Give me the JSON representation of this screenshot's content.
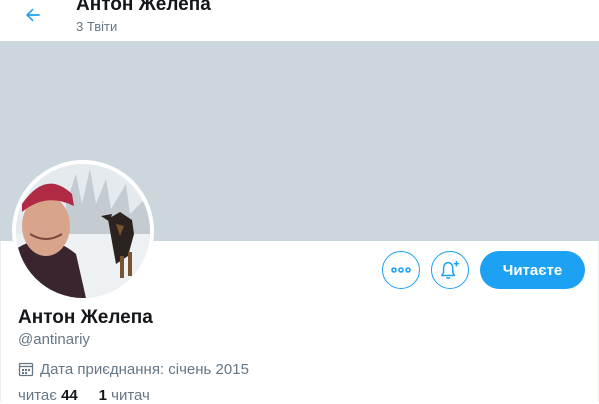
{
  "header": {
    "title": "Антон Желепа",
    "subtitle": "3 Твіти",
    "back_icon": "arrow-left-icon"
  },
  "profile": {
    "display_name": "Антон Желепа",
    "handle": "@antinariy",
    "joined": "Дата приєднання: січень 2015",
    "following_label": "читає",
    "following_count": "44",
    "followers_count": "1",
    "followers_label": "читач"
  },
  "actions": {
    "more_icon": "more-dots-icon",
    "notify_icon": "bell-plus-icon",
    "follow_label": "Читаєте"
  },
  "colors": {
    "accent": "#1da1f2",
    "banner": "#ccd6dd",
    "secondary_text": "#657786"
  }
}
